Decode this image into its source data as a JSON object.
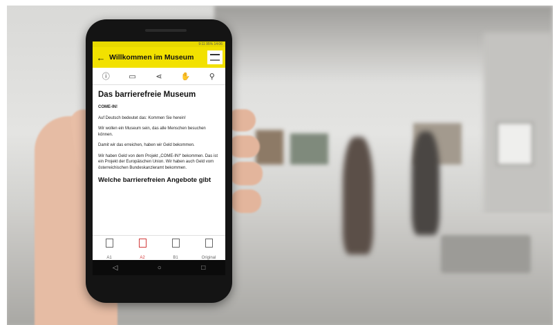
{
  "status_bar": {
    "right": "9:11 95% 14:06"
  },
  "app_bar": {
    "back_icon": "arrow-left-icon",
    "title": "Willkommen im Museum",
    "logo_icon": "come-in-logo"
  },
  "toolbar": [
    {
      "icon": "info-icon",
      "glyph": "ⓘ"
    },
    {
      "icon": "comment-icon",
      "glyph": "▭"
    },
    {
      "icon": "share-icon",
      "glyph": "⋖"
    },
    {
      "icon": "hand-icon",
      "glyph": "✋"
    },
    {
      "icon": "location-pin-icon",
      "glyph": "⚲"
    }
  ],
  "content": {
    "heading": "Das barrierefreie Museum",
    "label": "COME-IN!",
    "paragraphs": [
      "Auf Deutsch bedeutet das: Kommen Sie herein!",
      "Wir wollen ein Museum sein, das alle Menschen besuchen können.",
      "Damit wir das erreichen, haben wir Geld bekommen.",
      "Wir haben Geld von dem Projekt „COME-IN!“ bekommen. Das ist ein Projekt der Europäischen Union. Wir haben auch Geld vom österreichischen Bundeskanzleramt bekommen."
    ],
    "subheading": "Welche barrierefreien Angebote gibt"
  },
  "bottom_nav": [
    {
      "label": "A1",
      "active": false
    },
    {
      "label": "A2",
      "active": true
    },
    {
      "label": "B1",
      "active": false
    },
    {
      "label": "Original",
      "active": false
    }
  ],
  "soft_keys": {
    "back": "◁",
    "home": "○",
    "recent": "□"
  },
  "colors": {
    "app_bar": "#f2e100",
    "active_tab": "#d23a3a"
  }
}
